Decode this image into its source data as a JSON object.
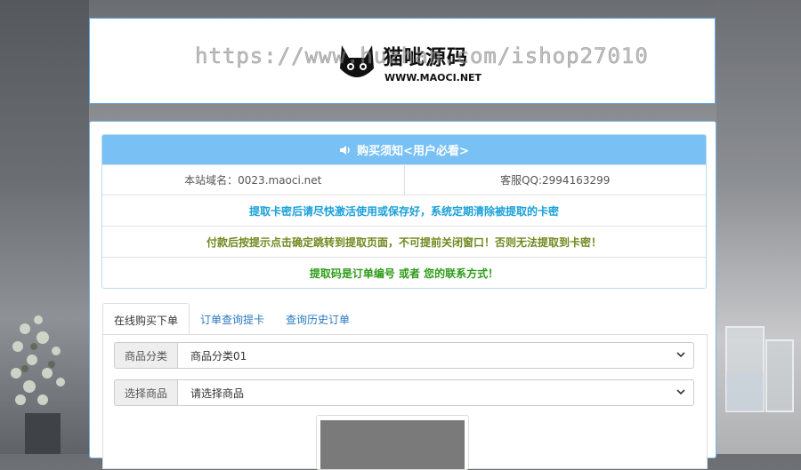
{
  "header": {
    "watermark": "https://www.huzhan.com/ishop27010",
    "logo_text": "猫呲源码",
    "logo_sub": "WWW.MAOCI.NET"
  },
  "notice": {
    "title": "购买须知<用户必看>",
    "site_domain": "本站域名：0023.maoci.net",
    "service_qq": "客服QQ:2994163299",
    "line1": "提取卡密后请尽快激活使用或保存好，系统定期清除被提取的卡密",
    "line2": "付款后按提示点击确定跳转到提取页面，不可提前关闭窗口！否则无法提取到卡密！",
    "line3": "提取码是订单编号 或者 您的联系方式！",
    "colors": {
      "head_bg": "#79c1f5",
      "line1": "#1aa0d8",
      "line2": "#6f8a1f",
      "line3": "#2e9c19"
    }
  },
  "tabs": [
    {
      "label": "在线购买下单"
    },
    {
      "label": "订单查询提卡"
    },
    {
      "label": "查询历史订单"
    }
  ],
  "form": {
    "category_label": "商品分类",
    "category_value": "商品分类01",
    "product_label": "选择商品",
    "product_value": "请选择商品"
  },
  "icons": [
    "speaker-icon",
    "chevron-down-icon",
    "cat-logo-icon"
  ]
}
